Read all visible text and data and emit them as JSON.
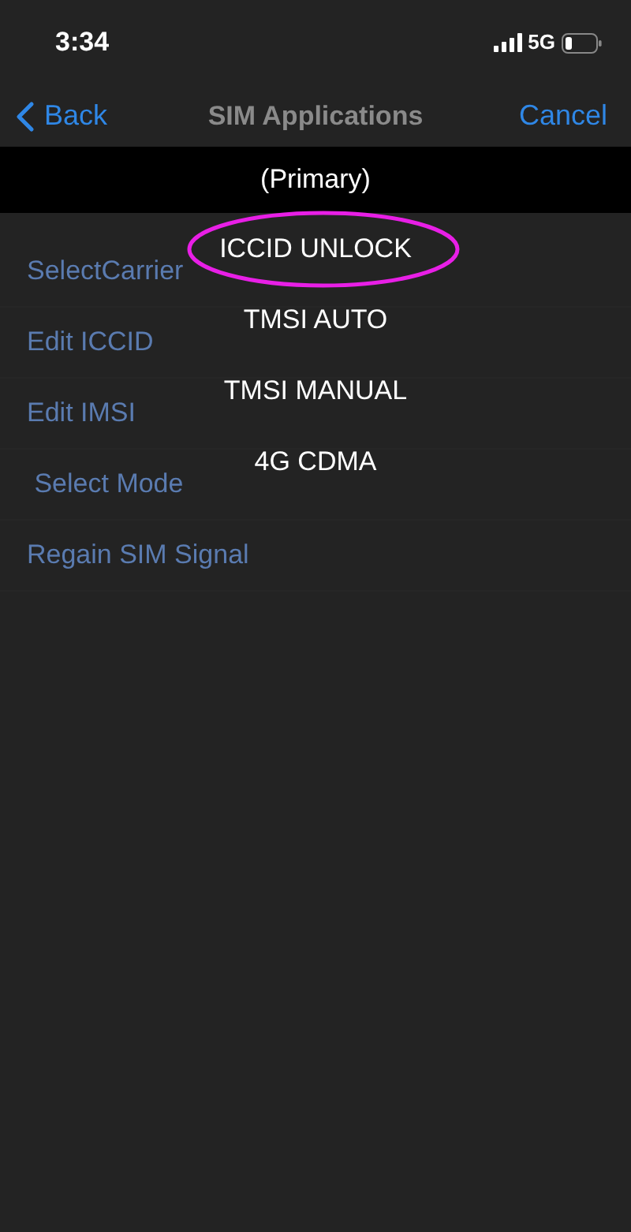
{
  "status_bar": {
    "time": "3:34",
    "network": "5G"
  },
  "nav_bar": {
    "back": "Back",
    "title": "SIM Applications",
    "cancel": "Cancel"
  },
  "list": [
    {
      "label": "SelectCarrier"
    },
    {
      "label": "Edit ICCID"
    },
    {
      "label": "Edit IMSI"
    },
    {
      "label": " Select Mode"
    },
    {
      "label": "Regain SIM Signal"
    }
  ],
  "menu": {
    "header": "(Primary)",
    "items": [
      {
        "label": "ICCID UNLOCK",
        "circled": true
      },
      {
        "label": "TMSI AUTO",
        "circled": false
      },
      {
        "label": "TMSI MANUAL",
        "circled": false
      },
      {
        "label": "4G CDMA",
        "circled": false
      }
    ]
  }
}
